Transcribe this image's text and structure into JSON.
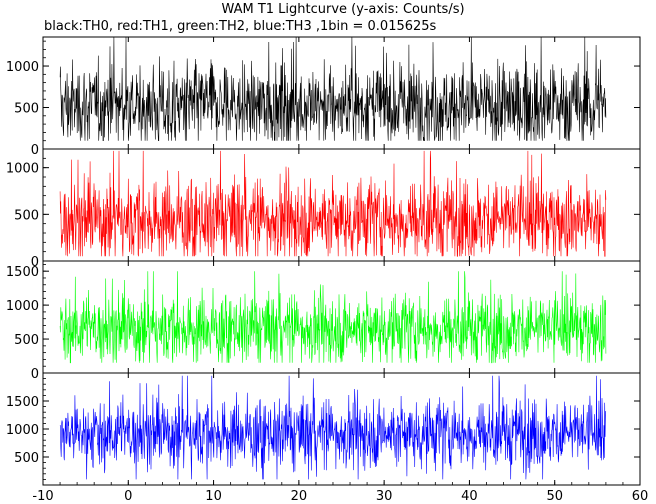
{
  "chart_data": {
    "type": "line",
    "title": "WAM T1 Lightcurve (y-axis: Counts/s)",
    "subtitle": "black:TH0, red:TH1, green:TH2, blue:TH3 ,1bin = 0.015625s",
    "xlabel": "",
    "ylabel": "",
    "xlim": [
      -10,
      60
    ],
    "x_ticks": [
      -10,
      0,
      10,
      20,
      30,
      40,
      50,
      60
    ],
    "x_data_range": [
      -8.0,
      56.0
    ],
    "grid": false,
    "panels": [
      {
        "color": "#000000",
        "ylim": [
          0,
          1350
        ],
        "y_ticks": [
          0,
          500,
          1000
        ],
        "approx_mean": 520,
        "approx_min": 100,
        "approx_max": 1350
      },
      {
        "color": "#ff0000",
        "ylim": [
          0,
          1200
        ],
        "y_ticks": [
          0,
          500,
          1000
        ],
        "approx_mean": 450,
        "approx_min": 50,
        "approx_max": 1180
      },
      {
        "color": "#00ff00",
        "ylim": [
          0,
          1650
        ],
        "y_ticks": [
          0,
          500,
          1000,
          1500
        ],
        "approx_mean": 660,
        "approx_min": 150,
        "approx_max": 1500
      },
      {
        "color": "#0000ff",
        "ylim": [
          0,
          2000
        ],
        "y_ticks": [
          500,
          1000,
          1500
        ],
        "approx_mean": 930,
        "approx_min": 100,
        "approx_max": 1950
      }
    ]
  }
}
